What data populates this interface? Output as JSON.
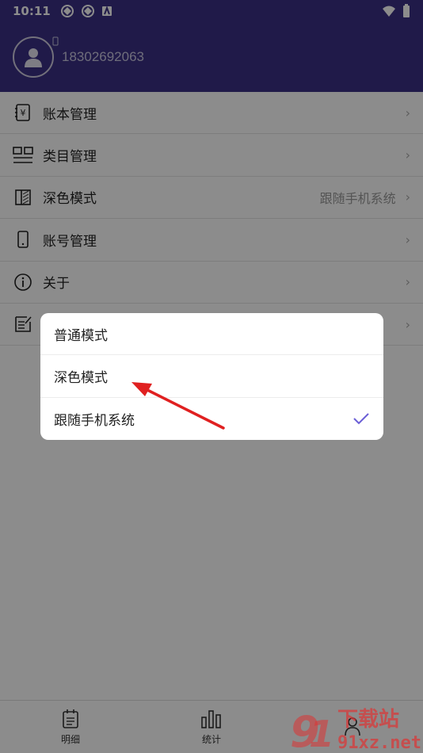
{
  "status_bar": {
    "time": "10:11"
  },
  "profile": {
    "phone": "18302692063"
  },
  "menu": [
    {
      "label": "账本管理",
      "value": ""
    },
    {
      "label": "类目管理",
      "value": ""
    },
    {
      "label": "深色模式",
      "value": "跟随手机系统"
    },
    {
      "label": "账号管理",
      "value": ""
    },
    {
      "label": "关于",
      "value": ""
    },
    {
      "label": "",
      "value": ""
    }
  ],
  "dialog": {
    "options": [
      {
        "label": "普通模式",
        "selected": false
      },
      {
        "label": "深色模式",
        "selected": false
      },
      {
        "label": "跟随手机系统",
        "selected": true
      }
    ]
  },
  "tabbar": {
    "tabs": [
      {
        "label": "明细"
      },
      {
        "label": "统计"
      },
      {
        "label": ""
      }
    ]
  },
  "watermark": {
    "text_top": "下载站",
    "text_bottom": "91xz.net"
  },
  "colors": {
    "header": "#3b3085",
    "accent": "#6b5fd6",
    "arrow": "#e02020"
  }
}
